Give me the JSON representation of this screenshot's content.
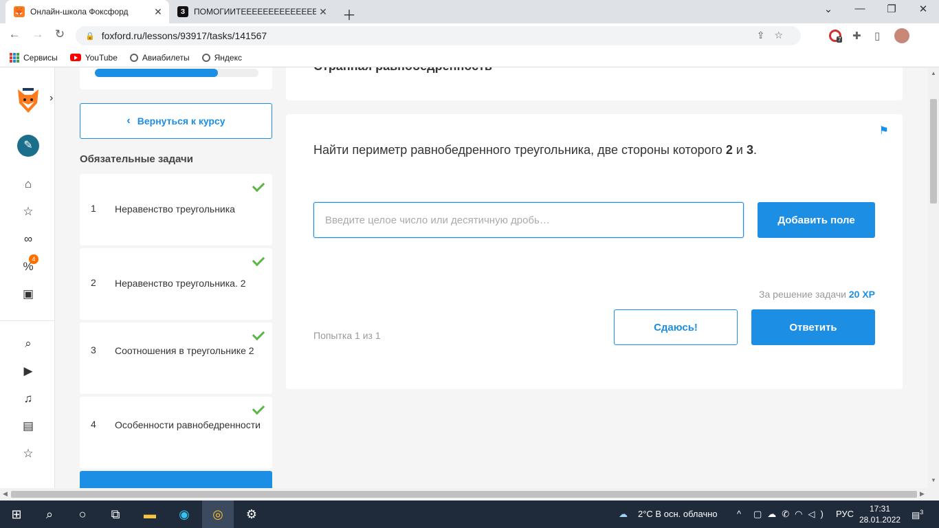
{
  "browser": {
    "tabs": [
      {
        "title": "Онлайн-школа Фоксфорд",
        "active": true
      },
      {
        "title": "ПОМОГИИТЕЕЕЕЕЕЕЕЕЕЕЕЕЕЕ - Ш",
        "active": false
      }
    ],
    "url": "foxford.ru/lessons/93917/tasks/141567",
    "bookmarks": [
      "Сервисы",
      "YouTube",
      "Авиабилеты",
      "Яндекс"
    ],
    "extension_badge": "7"
  },
  "sidebar": {
    "notification_badge": "4"
  },
  "course": {
    "progress_percent": 75,
    "back_label": "Вернуться к курсу",
    "section_title": "Обязательные задачи",
    "tasks": [
      {
        "num": "1",
        "name": "Неравенство треугольника",
        "done": true
      },
      {
        "num": "2",
        "name": "Неравенство треугольника. 2",
        "done": true
      },
      {
        "num": "3",
        "name": "Соотношения в треугольнике 2",
        "done": true
      },
      {
        "num": "4",
        "name": "Особенности равнобедренности",
        "done": true
      }
    ]
  },
  "task": {
    "header_title": "Странная равнобедренность",
    "question_prefix": "Найти периметр равнобедренного треугольника, две стороны которого ",
    "value_a": "2",
    "conj": " и ",
    "value_b": "3",
    "question_suffix": ".",
    "input_placeholder": "Введите целое число или десятичную дробь…",
    "add_field_label": "Добавить поле",
    "reward_label": "За решение задачи ",
    "reward_xp": "20 XP",
    "attempt_label": "Попытка 1 из 1",
    "giveup_label": "Сдаюсь!",
    "submit_label": "Ответить"
  },
  "taskbar": {
    "weather": "2°C  В осн. облачно",
    "lang": "РУС",
    "time": "17:31",
    "date": "28.01.2022",
    "notifications": "3"
  }
}
